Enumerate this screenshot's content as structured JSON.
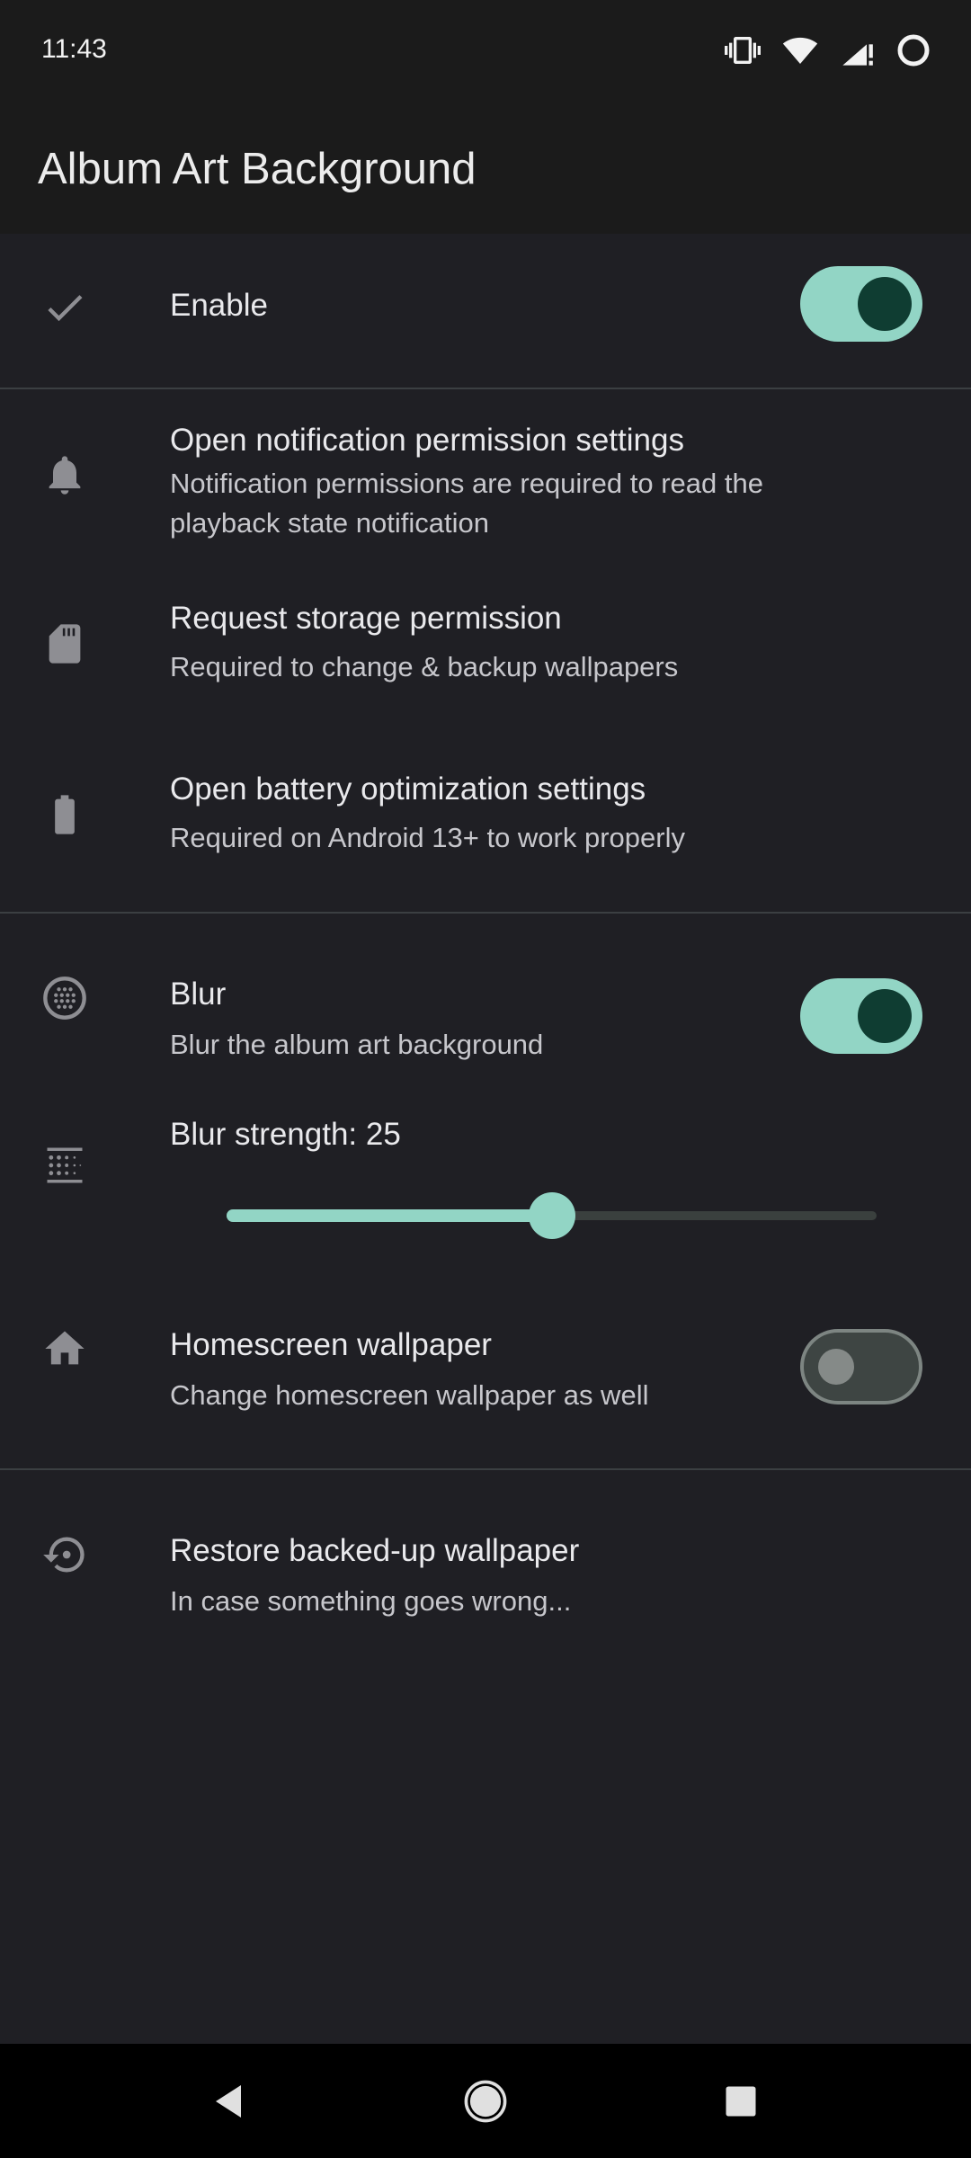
{
  "status_bar": {
    "time": "11:43",
    "icons": [
      "vibrate-icon",
      "wifi-icon",
      "signal-icon",
      "circle-icon"
    ]
  },
  "app_bar": {
    "title": "Album Art Background"
  },
  "settings": {
    "enable": {
      "title": "Enable",
      "icon": "check-icon",
      "checked": true
    },
    "notification": {
      "title": "Open notification permission settings",
      "subtitle": "Notification permissions are required to read the playback state notification",
      "icon": "bell-icon"
    },
    "storage": {
      "title": "Request storage permission",
      "subtitle": "Required to change & backup wallpapers",
      "icon": "sd-card-icon"
    },
    "battery": {
      "title": "Open battery optimization settings",
      "subtitle": "Required on Android 13+ to work properly",
      "icon": "battery-icon"
    },
    "blur": {
      "title": "Blur",
      "subtitle": "Blur the album art background",
      "icon": "blur-circle-icon",
      "checked": true
    },
    "blur_strength": {
      "title": "Blur strength: 25",
      "icon": "blur-linear-icon",
      "value": 25,
      "min": 0,
      "max": 50
    },
    "homescreen": {
      "title": "Homescreen wallpaper",
      "subtitle": "Change homescreen wallpaper as well",
      "icon": "home-icon",
      "checked": false
    },
    "restore": {
      "title": "Restore backed-up wallpaper",
      "subtitle": "In case something goes wrong...",
      "icon": "restore-icon"
    }
  },
  "nav_bar": {
    "buttons": [
      "back-icon",
      "home-circle-icon",
      "recents-icon"
    ]
  },
  "colors": {
    "accent": "#92d5c5",
    "accent_dark": "#0f3d32",
    "background": "#1f1f24",
    "icon": "#8e8e93"
  }
}
